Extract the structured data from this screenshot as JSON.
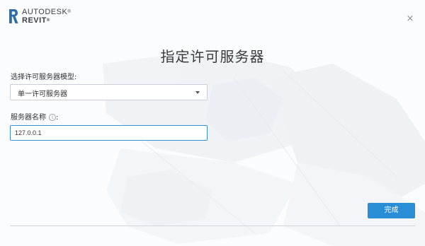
{
  "brand": {
    "company": "AUTODESK",
    "product": "REVIT",
    "logo_icon": "revit-r-icon"
  },
  "window": {
    "close_icon": "close-icon",
    "close_label": "×"
  },
  "heading": "指定许可服务器",
  "model": {
    "label": "选择许可服务器模型:",
    "selected": "单一许可服务器"
  },
  "server": {
    "label": "服务器名称",
    "label_suffix": ":",
    "info_icon": "info-icon",
    "value": "127.0.0.1"
  },
  "finish_label": "完成",
  "colors": {
    "accent": "#2a8ed6",
    "input_focus": "#3a8fd0",
    "text": "#333333"
  }
}
